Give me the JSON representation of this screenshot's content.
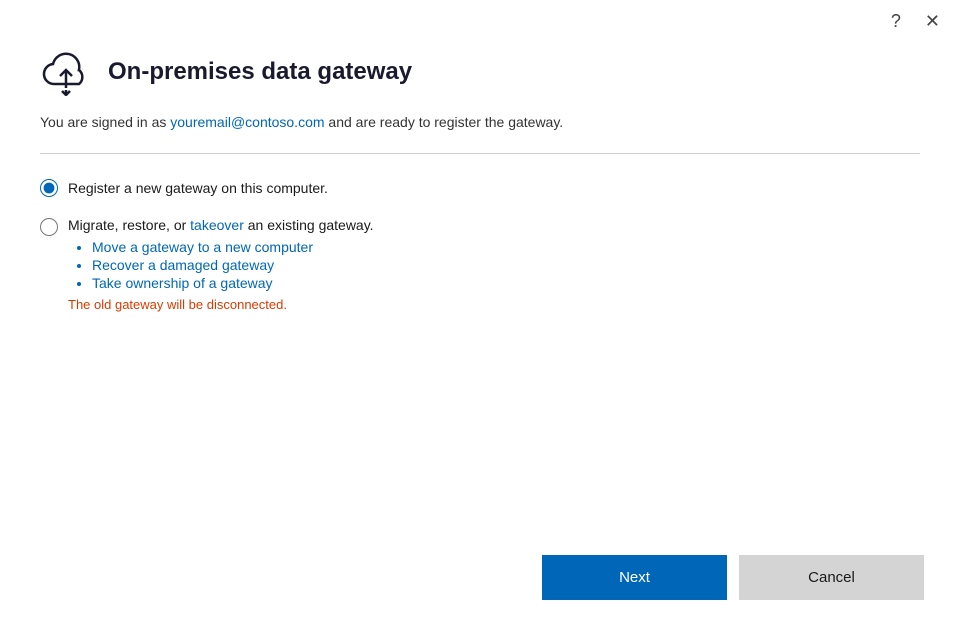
{
  "dialog": {
    "title": "On-premises data gateway",
    "help_icon": "?",
    "close_icon": "✕",
    "signed_in_prefix": "You are signed in as ",
    "email": "youremail@contoso.com",
    "signed_in_suffix": " and are ready to register the gateway.",
    "radio_option1": {
      "label": "Register a new gateway on this computer.",
      "checked": true
    },
    "radio_option2": {
      "label_prefix": "Migrate, restore, or ",
      "label_link": "takeover",
      "label_suffix": " an existing gateway.",
      "bullets": [
        "Move a gateway to a new computer",
        "Recover a damaged gateway",
        "Take ownership of a gateway"
      ],
      "note": "The old gateway will be disconnected."
    },
    "footer": {
      "next_label": "Next",
      "cancel_label": "Cancel"
    }
  }
}
